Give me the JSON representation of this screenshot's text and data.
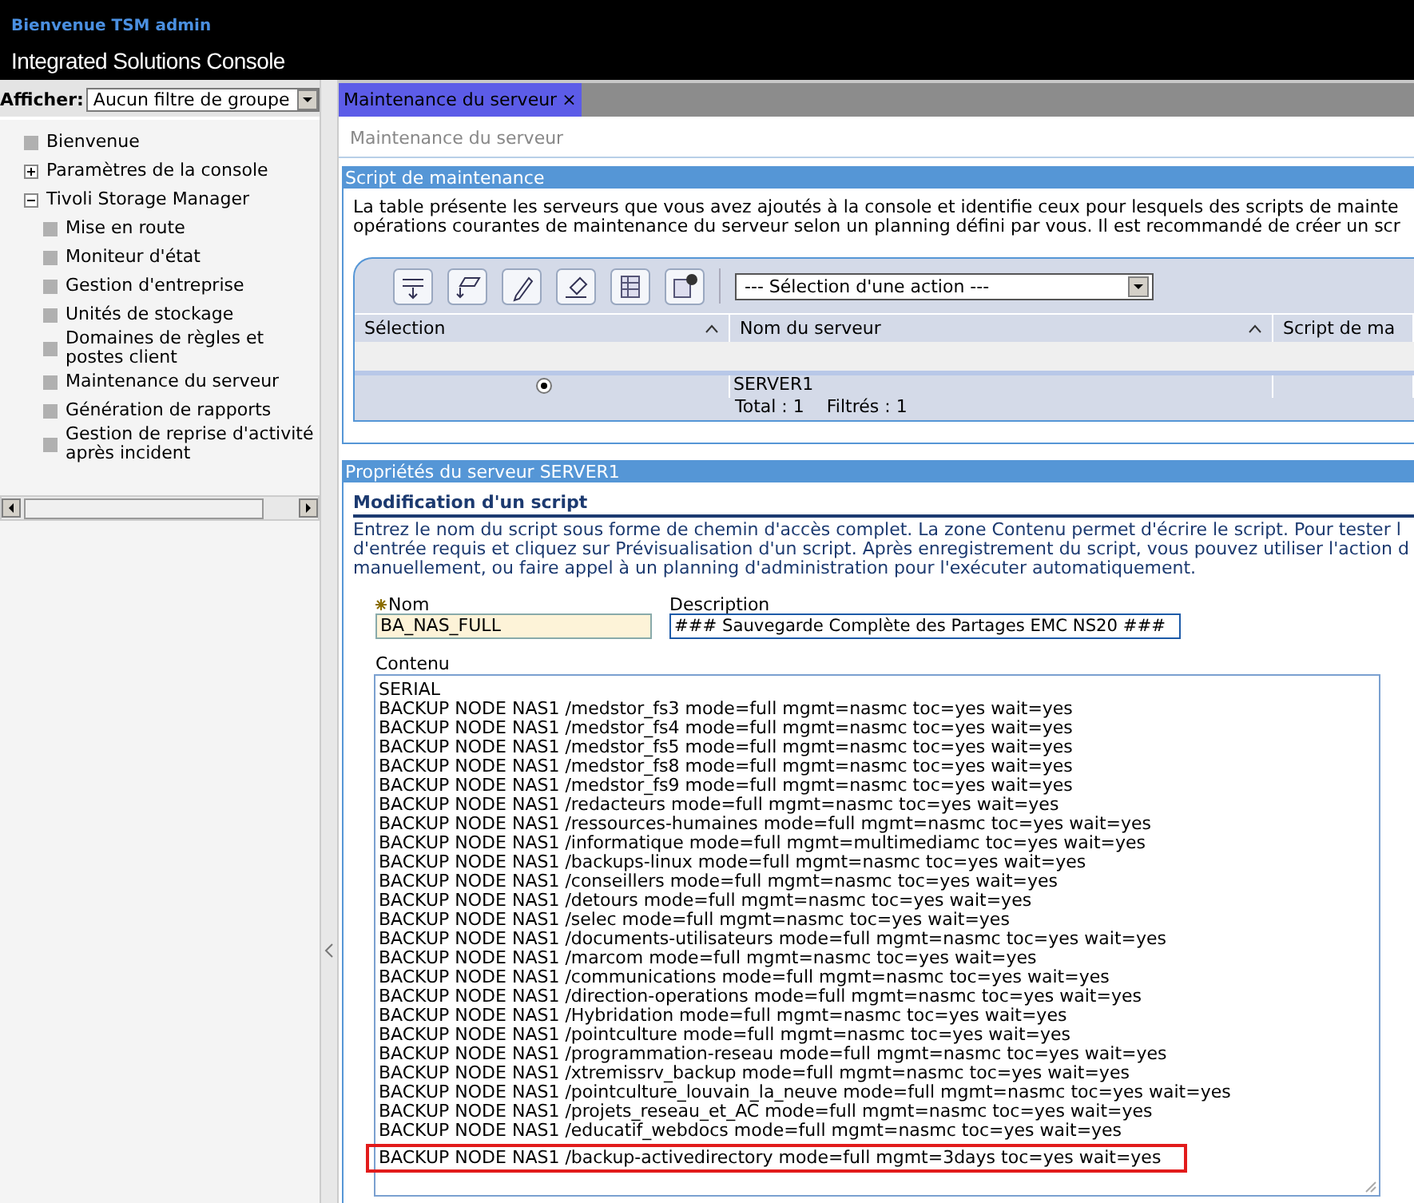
{
  "header": {
    "welcome": "Bienvenue TSM admin",
    "title": "Integrated Solutions Console"
  },
  "sidebar": {
    "filter_label": "Afficher:",
    "filter_value": "Aucun filtre de groupe",
    "items": [
      {
        "label": "Bienvenue",
        "kind": "leaf"
      },
      {
        "label": "Paramètres de la console",
        "kind": "folder",
        "expanded": false
      },
      {
        "label": "Tivoli Storage Manager",
        "kind": "folder",
        "expanded": true,
        "children": [
          {
            "label": "Mise en route",
            "kind": "leaf"
          },
          {
            "label": "Moniteur d'état",
            "kind": "leaf"
          },
          {
            "label": "Gestion d'entreprise",
            "kind": "leaf"
          },
          {
            "label": "Unités de stockage",
            "kind": "leaf"
          },
          {
            "label": "Domaines de règles et postes client",
            "kind": "leaf"
          },
          {
            "label": "Maintenance du serveur",
            "kind": "leaf"
          },
          {
            "label": "Génération de rapports",
            "kind": "leaf"
          },
          {
            "label": "Gestion de reprise d'activité après incident",
            "kind": "leaf"
          }
        ]
      }
    ]
  },
  "tabs": [
    {
      "label": "Maintenance du serveur",
      "close": "×",
      "selected": true
    }
  ],
  "breadcrumb": "Maintenance du serveur",
  "maintenance_section": {
    "title": "Script de maintenance",
    "description": [
      "La table présente les serveurs que vous avez ajoutés à la console et identifie ceux pour lesquels des scripts de mainte",
      "opérations courantes de maintenance du serveur selon un planning défini par vous. Il est recommandé de créer un scr"
    ],
    "action_select": "--- Sélection d'une action ---",
    "table": {
      "columns": [
        "Sélection",
        "Nom du serveur",
        "Script de ma"
      ],
      "rows": [
        {
          "selected": true,
          "server": "SERVER1"
        }
      ],
      "footer": {
        "total": "Total : 1",
        "filtered": "Filtrés : 1"
      }
    }
  },
  "properties_section": {
    "title": "Propriétés du serveur SERVER1",
    "subtitle": "Modification d'un script",
    "description": [
      "Entrez le nom du script sous forme de chemin d'accès complet. La zone Contenu permet d'écrire le script. Pour tester l",
      "d'entrée requis et cliquez sur Prévisualisation d'un script. Après enregistrement du script, vous pouvez utiliser l'action d",
      "manuellement, ou faire appel à un planning d'administration pour l'exécuter automatiquement."
    ],
    "name_field": {
      "label": "Nom",
      "required": true,
      "value": "BA_NAS_FULL"
    },
    "description_field": {
      "label": "Description",
      "value": "### Sauvegarde Complète des Partages EMC NS20 ###"
    },
    "content_label": "Contenu",
    "content_lines": [
      {
        "text": "SERIAL",
        "highlighted": false
      },
      {
        "text": "BACKUP NODE NAS1 /medstor_fs3 mode=full mgmt=nasmc toc=yes wait=yes",
        "highlighted": false
      },
      {
        "text": "BACKUP NODE NAS1 /medstor_fs4 mode=full mgmt=nasmc toc=yes wait=yes",
        "highlighted": false
      },
      {
        "text": "BACKUP NODE NAS1 /medstor_fs5 mode=full mgmt=nasmc toc=yes wait=yes",
        "highlighted": false
      },
      {
        "text": "BACKUP NODE NAS1 /medstor_fs8 mode=full mgmt=nasmc toc=yes wait=yes",
        "highlighted": false
      },
      {
        "text": "BACKUP NODE NAS1 /medstor_fs9 mode=full mgmt=nasmc toc=yes wait=yes",
        "highlighted": false
      },
      {
        "text": "BACKUP NODE NAS1 /redacteurs mode=full mgmt=nasmc toc=yes wait=yes",
        "highlighted": false
      },
      {
        "text": "BACKUP NODE NAS1 /ressources-humaines mode=full mgmt=nasmc toc=yes wait=yes",
        "highlighted": false
      },
      {
        "text": "BACKUP NODE NAS1 /informatique mode=full mgmt=multimediamc toc=yes wait=yes",
        "highlighted": false
      },
      {
        "text": "BACKUP NODE NAS1 /backups-linux mode=full mgmt=nasmc toc=yes wait=yes",
        "highlighted": false
      },
      {
        "text": "BACKUP NODE NAS1 /conseillers mode=full mgmt=nasmc toc=yes wait=yes",
        "highlighted": false
      },
      {
        "text": "BACKUP NODE NAS1 /detours mode=full mgmt=nasmc toc=yes wait=yes",
        "highlighted": false
      },
      {
        "text": "BACKUP NODE NAS1 /selec mode=full mgmt=nasmc toc=yes wait=yes",
        "highlighted": false
      },
      {
        "text": "BACKUP NODE NAS1 /documents-utilisateurs mode=full mgmt=nasmc toc=yes wait=yes",
        "highlighted": false
      },
      {
        "text": "BACKUP NODE NAS1 /marcom mode=full mgmt=nasmc toc=yes wait=yes",
        "highlighted": false
      },
      {
        "text": "BACKUP NODE NAS1 /communications mode=full mgmt=nasmc toc=yes wait=yes",
        "highlighted": false
      },
      {
        "text": "BACKUP NODE NAS1 /direction-operations mode=full mgmt=nasmc toc=yes wait=yes",
        "highlighted": false
      },
      {
        "text": "BACKUP NODE NAS1 /Hybridation mode=full mgmt=nasmc toc=yes wait=yes",
        "highlighted": false
      },
      {
        "text": "BACKUP NODE NAS1 /pointculture mode=full mgmt=nasmc toc=yes wait=yes",
        "highlighted": false
      },
      {
        "text": "BACKUP NODE NAS1 /programmation-reseau mode=full mgmt=nasmc toc=yes wait=yes",
        "highlighted": false
      },
      {
        "text": "BACKUP NODE NAS1 /xtremissrv_backup mode=full mgmt=nasmc toc=yes wait=yes",
        "highlighted": false
      },
      {
        "text": "BACKUP NODE NAS1 /pointculture_louvain_la_neuve mode=full mgmt=nasmc toc=yes wait=yes",
        "highlighted": false
      },
      {
        "text": "BACKUP NODE NAS1 /projets_reseau_et_AC mode=full mgmt=nasmc toc=yes wait=yes",
        "highlighted": false
      },
      {
        "text": "BACKUP NODE NAS1 /educatif_webdocs mode=full mgmt=nasmc toc=yes wait=yes",
        "highlighted": false
      },
      {
        "text": "BACKUP NODE NAS1 /backup-activedirectory mode=full mgmt=3days toc=yes wait=yes",
        "highlighted": true
      }
    ]
  }
}
